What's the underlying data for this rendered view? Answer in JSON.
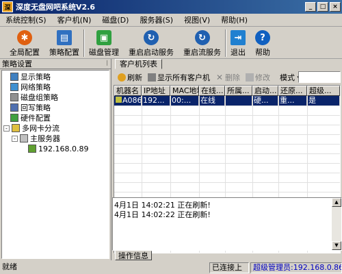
{
  "window": {
    "title": "深度无盘网吧系统V2.6",
    "min_label": "_",
    "max_label": "□",
    "close_label": "×"
  },
  "menu": [
    {
      "label": "系统控制(S)"
    },
    {
      "label": "客户机(N)"
    },
    {
      "label": "磁盘(D)"
    },
    {
      "label": "服务器(S)"
    },
    {
      "label": "视图(V)"
    },
    {
      "label": "帮助(H)"
    }
  ],
  "toolbar": [
    {
      "label": "全局配置",
      "icon": "gear-icon",
      "color": "#e06010"
    },
    {
      "label": "策略配置",
      "icon": "policy-icon",
      "color": "#3070c0"
    },
    {
      "label": "磁盘管理",
      "icon": "disk-icon",
      "color": "#30a040"
    },
    {
      "label": "重启启动服务",
      "icon": "restart-icon",
      "color": "#2060b0"
    },
    {
      "label": "重启流服务",
      "icon": "restart-stream-icon",
      "color": "#2060b0"
    },
    {
      "label": "退出",
      "icon": "exit-icon",
      "color": "#2080d0"
    },
    {
      "label": "帮助",
      "icon": "help-icon",
      "color": "#1060c0"
    }
  ],
  "left_panel": {
    "title": "策略设置",
    "pin": "ᛁ",
    "tree": [
      {
        "label": "显示策略",
        "level": 1
      },
      {
        "label": "网络策略",
        "level": 1
      },
      {
        "label": "磁盘组策略",
        "level": 1
      },
      {
        "label": "回写策略",
        "level": 1
      },
      {
        "label": "硬件配置",
        "level": 1
      },
      {
        "label": "多网卡分流",
        "level": 0,
        "expander": "-"
      },
      {
        "label": "主服务器",
        "level": 1,
        "expander": "-"
      },
      {
        "label": "192.168.0.89",
        "level": 2
      }
    ]
  },
  "right_panel": {
    "tab": "客户机列表",
    "buttons": {
      "refresh": "刷新",
      "show_all": "显示所有客户机",
      "delete": "删除",
      "modify": "修改",
      "mode": "模式 ▾"
    },
    "columns": [
      "机器名",
      "IP地址",
      "MAC地址",
      "在线...",
      "所属...",
      "启动...",
      "还原...",
      "超级..."
    ],
    "rows": [
      [
        "A086",
        "192...",
        "00:...",
        "在线",
        "",
        "硬...",
        "重...",
        "是"
      ]
    ]
  },
  "log": {
    "lines": [
      "4月1日 14:02:21  正在刷新!",
      "4月1日 14:02:22  正在刷新!"
    ],
    "tab": "操作信息"
  },
  "status": {
    "ready": "就绪",
    "connected": "已连接上",
    "admin": "超级管理员:192.168.0.86"
  }
}
